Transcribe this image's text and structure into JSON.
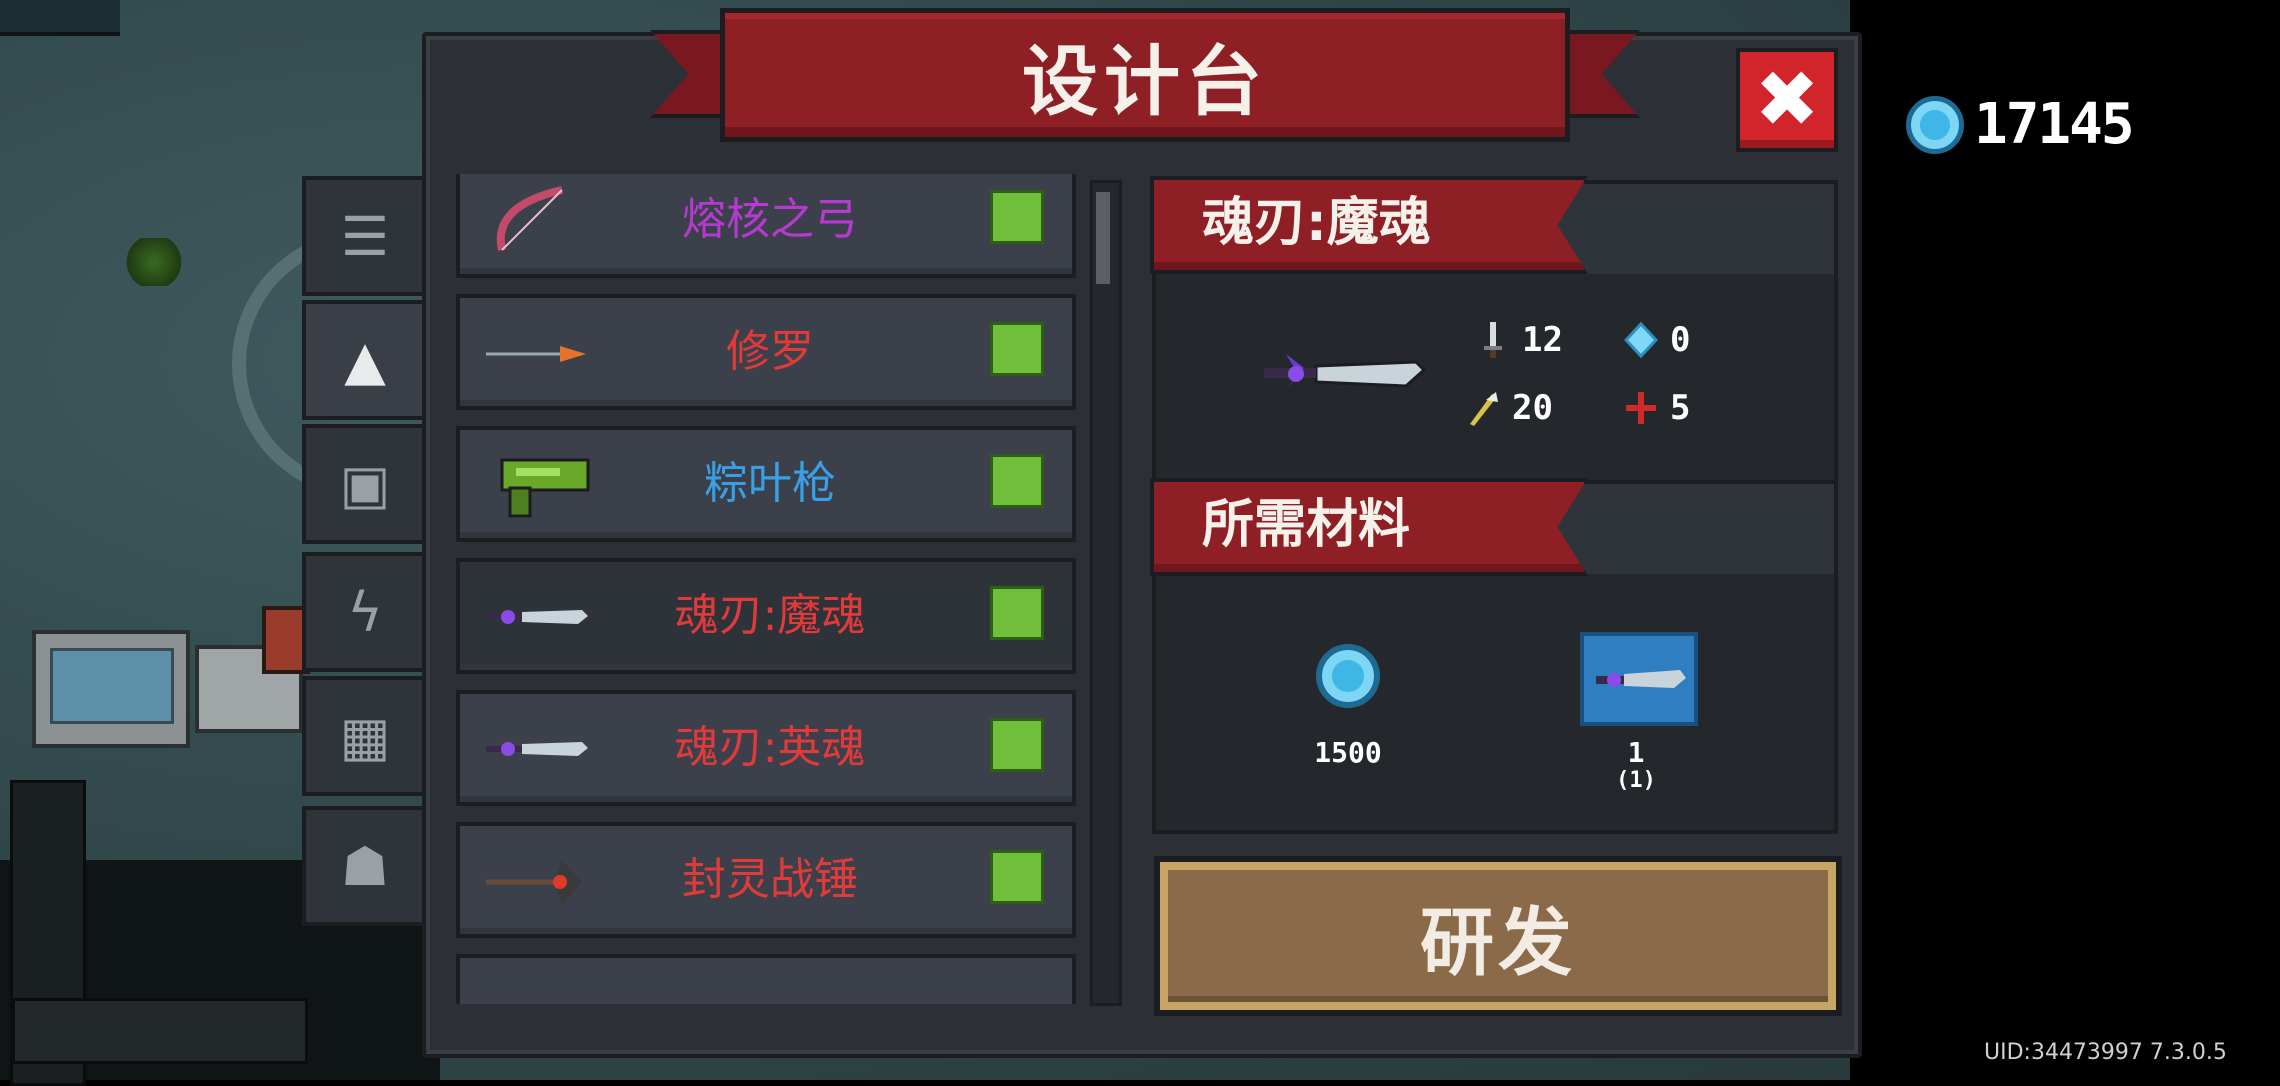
{
  "title": "设计台",
  "close_label": "✖",
  "currency": {
    "icon": "gem-icon",
    "value": "17145"
  },
  "side_tabs": [
    {
      "icon": "list-icon",
      "glyph": "☰"
    },
    {
      "icon": "gun-icon",
      "glyph": "▲"
    },
    {
      "icon": "armor-icon",
      "glyph": "▣"
    },
    {
      "icon": "lightning-icon",
      "glyph": "ϟ"
    },
    {
      "icon": "materials-icon",
      "glyph": "▦"
    },
    {
      "icon": "monster-icon",
      "glyph": "☗"
    }
  ],
  "items": [
    {
      "name": "熔核之弓",
      "color": "#b63ad0",
      "icon": "bow-icon"
    },
    {
      "name": "修罗",
      "color": "#e03a3a",
      "icon": "arrow-icon"
    },
    {
      "name": "粽叶枪",
      "color": "#3aa0e6",
      "icon": "green-gun-icon"
    },
    {
      "name": "魂刃:魔魂",
      "color": "#e03a3a",
      "icon": "soul-blade-icon"
    },
    {
      "name": "魂刃:英魂",
      "color": "#e03a3a",
      "icon": "soul-blade-icon"
    },
    {
      "name": "封灵战锤",
      "color": "#e03a3a",
      "icon": "hammer-icon"
    }
  ],
  "selected_index": 3,
  "detail": {
    "name": "魂刃:魔魂",
    "stats": {
      "damage": "12",
      "energy": "0",
      "crit": "20",
      "accuracy": "5"
    },
    "materials_title": "所需材料",
    "materials": [
      {
        "icon": "gem-icon",
        "amount": "1500"
      },
      {
        "icon": "blueprint-icon",
        "amount": "1",
        "owned": "(1)"
      }
    ]
  },
  "research_label": "研发",
  "uid_text": "UID:34473997 7.3.0.5"
}
